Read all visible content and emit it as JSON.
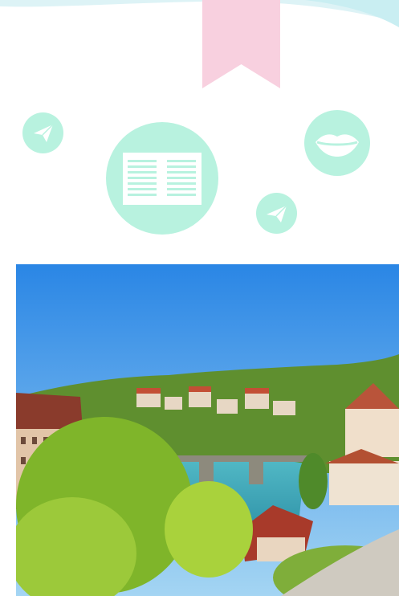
{
  "colors": {
    "mint": "#b8f2df",
    "mint_dark": "#a7ebd4",
    "bookmark_pink": "#f8d0df",
    "wave_blue": "#ddf3f6",
    "sky_top": "#2a86e5",
    "sky_bottom": "#9fd3f3",
    "river": "#3ea9b8",
    "tree_green": "#8fbf2a"
  },
  "icons": {
    "bookmark": "bookmark-icon",
    "plane_left": "paper-plane-icon",
    "book": "open-book-icon",
    "plane_right": "paper-plane-icon",
    "lips": "lips-icon"
  },
  "photo": {
    "subject": "city-riverside-photo"
  }
}
